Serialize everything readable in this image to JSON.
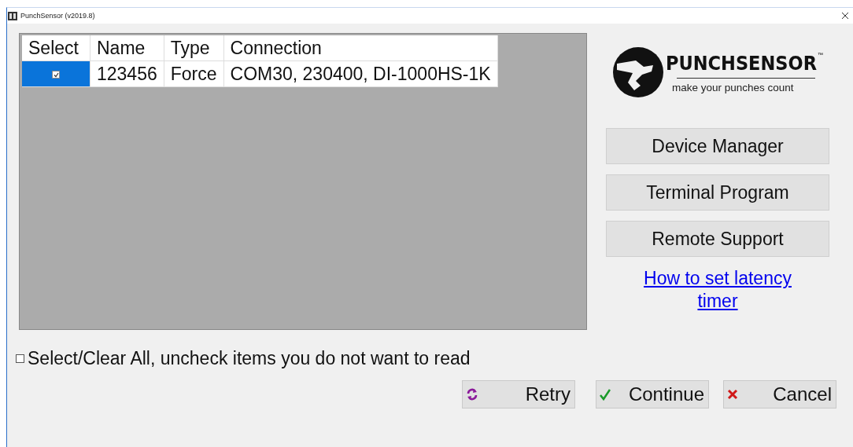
{
  "window": {
    "title": "PunchSensor (v2019.8)"
  },
  "table": {
    "columns": [
      "Select",
      "Name",
      "Type",
      "Connection"
    ],
    "rows": [
      {
        "selected": true,
        "checked": true,
        "cells": [
          "",
          "123456",
          "Force",
          "COM30, 230400, DI-1000HS-1K"
        ]
      }
    ]
  },
  "logo": {
    "name": "PUNCHSENSOR",
    "trademark": "™",
    "tagline": "make your punches count"
  },
  "side_buttons": [
    "Device Manager",
    "Terminal Program",
    "Remote Support"
  ],
  "link": "How to set latency timer",
  "select_all": {
    "label": "Select/Clear All, uncheck items you do not want to read",
    "checked": false
  },
  "buttons": [
    {
      "kind": "retry",
      "label": "Retry"
    },
    {
      "kind": "continue",
      "label": "Continue"
    },
    {
      "kind": "cancel",
      "label": "Cancel"
    }
  ]
}
